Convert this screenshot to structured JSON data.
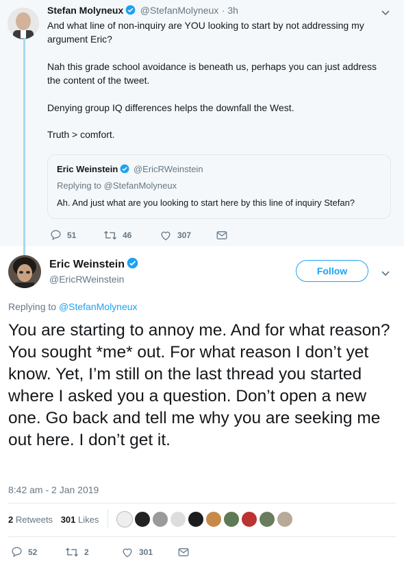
{
  "parent": {
    "name": "Stefan Molyneux",
    "handle": "@StefanMolyneux",
    "time": "· 3h",
    "text1": "And what line of non-inquiry are YOU looking to start by not addressing my argument Eric?",
    "text2": "Nah this grade school avoidance is beneath us, perhaps you can just address the content of the tweet.",
    "text3": "Denying group IQ differences helps the downfall the West.",
    "text4": "Truth > comfort.",
    "quote": {
      "name": "Eric Weinstein",
      "handle": "@EricRWeinstein",
      "replying_prefix": "Replying to",
      "replying_to": "@StefanMolyneux",
      "text": "Ah. And just what are you looking to start here by this line of inquiry Stefan?"
    },
    "replies": "51",
    "retweets": "46",
    "likes": "307"
  },
  "main": {
    "name": "Eric Weinstein",
    "handle": "@EricRWeinstein",
    "follow_label": "Follow",
    "replying_prefix": "Replying to",
    "replying_to": "@StefanMolyneux",
    "text": "You are starting to annoy me. And for what reason? You sought *me* out. For what reason I don’t yet know. Yet, I’m still on the last thread you started where I asked you a question. Don’t open a new one. Go back and tell me why you are seeking me out here. I don’t get it.",
    "timestamp": "8:42 am - 2 Jan 2019",
    "retweet_count": "2",
    "retweet_label": "Retweets",
    "like_count": "301",
    "like_label": "Likes",
    "replies": "52",
    "retweets": "2",
    "likes": "301"
  },
  "colors": {
    "accent": "#1da1f2",
    "muted": "#657786",
    "thread": "#a5d9f0"
  }
}
